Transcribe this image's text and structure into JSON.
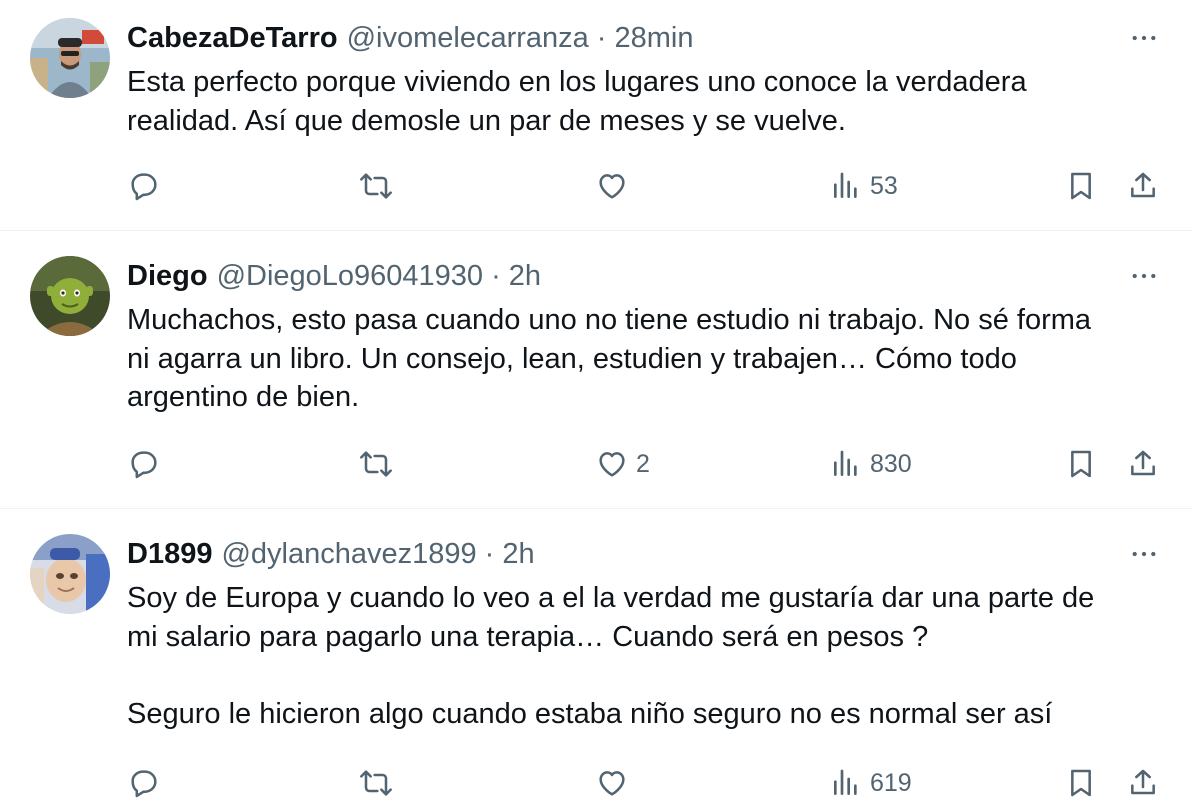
{
  "tweets": [
    {
      "name": "CabezaDeTarro",
      "handle": "@ivomelecarranza",
      "separator": "·",
      "time": "28min",
      "lines": [
        "Esta perfecto porque viviendo en los lugares uno conoce la verdadera",
        "realidad. Así que demosle un par de meses y se vuelve."
      ],
      "replies": "",
      "reposts": "",
      "likes": "",
      "views": "53"
    },
    {
      "name": "Diego",
      "handle": "@DiegoLo96041930",
      "separator": "·",
      "time": "2h",
      "lines": [
        "Muchachos, esto pasa cuando uno no tiene estudio ni trabajo. No sé forma",
        "ni agarra un libro. Un consejo, lean, estudien y trabajen… Cómo todo",
        "argentino de bien."
      ],
      "replies": "",
      "reposts": "",
      "likes": "2",
      "views": "830"
    },
    {
      "name": "D1899",
      "handle": "@dylanchavez1899",
      "separator": "·",
      "time": "2h",
      "lines": [
        "Soy de Europa y cuando lo veo a el la verdad me gustaría dar una parte de",
        "mi salario para pagarlo una terapia… Cuando será en pesos ?",
        "",
        "Seguro le hicieron algo cuando estaba niño seguro no es normal ser así"
      ],
      "replies": "",
      "reposts": "",
      "likes": "",
      "views": "619"
    }
  ],
  "icons": {
    "reply": "reply-icon",
    "repost": "repost-icon",
    "like": "heart-icon",
    "views": "views-icon",
    "bookmark": "bookmark-icon",
    "share": "share-icon",
    "more": "more-icon"
  },
  "colors": {
    "text": "#0f1419",
    "secondary": "#536471",
    "divider": "#eff3f4"
  }
}
